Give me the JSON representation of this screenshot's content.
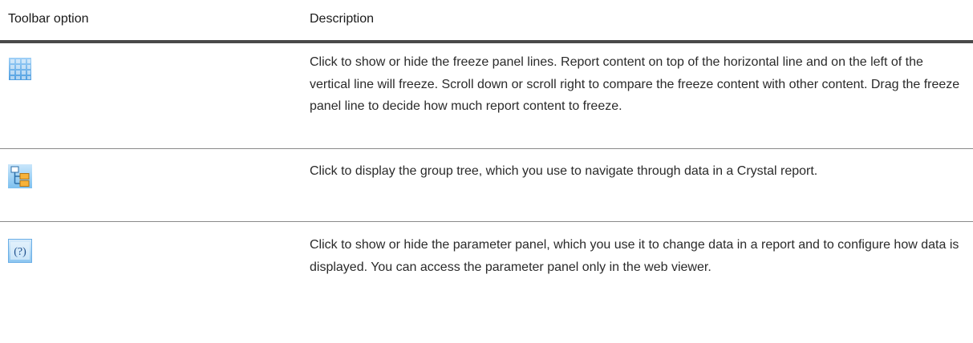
{
  "header": {
    "col1": "Toolbar option",
    "col2": "Description"
  },
  "rows": [
    {
      "icon": "freeze-panel-icon",
      "description": "Click to show or hide the freeze panel lines. Report content on top of the horizontal line and on the left of the vertical line will freeze. Scroll down or scroll right to compare the freeze content with other content. Drag the freeze panel line to decide how much report content to freeze."
    },
    {
      "icon": "group-tree-icon",
      "description": "Click to display the group tree, which you use to navigate through data in a Crystal report."
    },
    {
      "icon": "parameter-panel-icon",
      "description": "Click to show or hide the parameter panel, which you use it to change data in a report and to configure how data is displayed. You can access the parameter panel only in the web viewer."
    }
  ],
  "colors": {
    "header_rule": "#4a4a4a",
    "row_rule": "#8a8a8a",
    "icon_blue": "#5aa8e6"
  }
}
